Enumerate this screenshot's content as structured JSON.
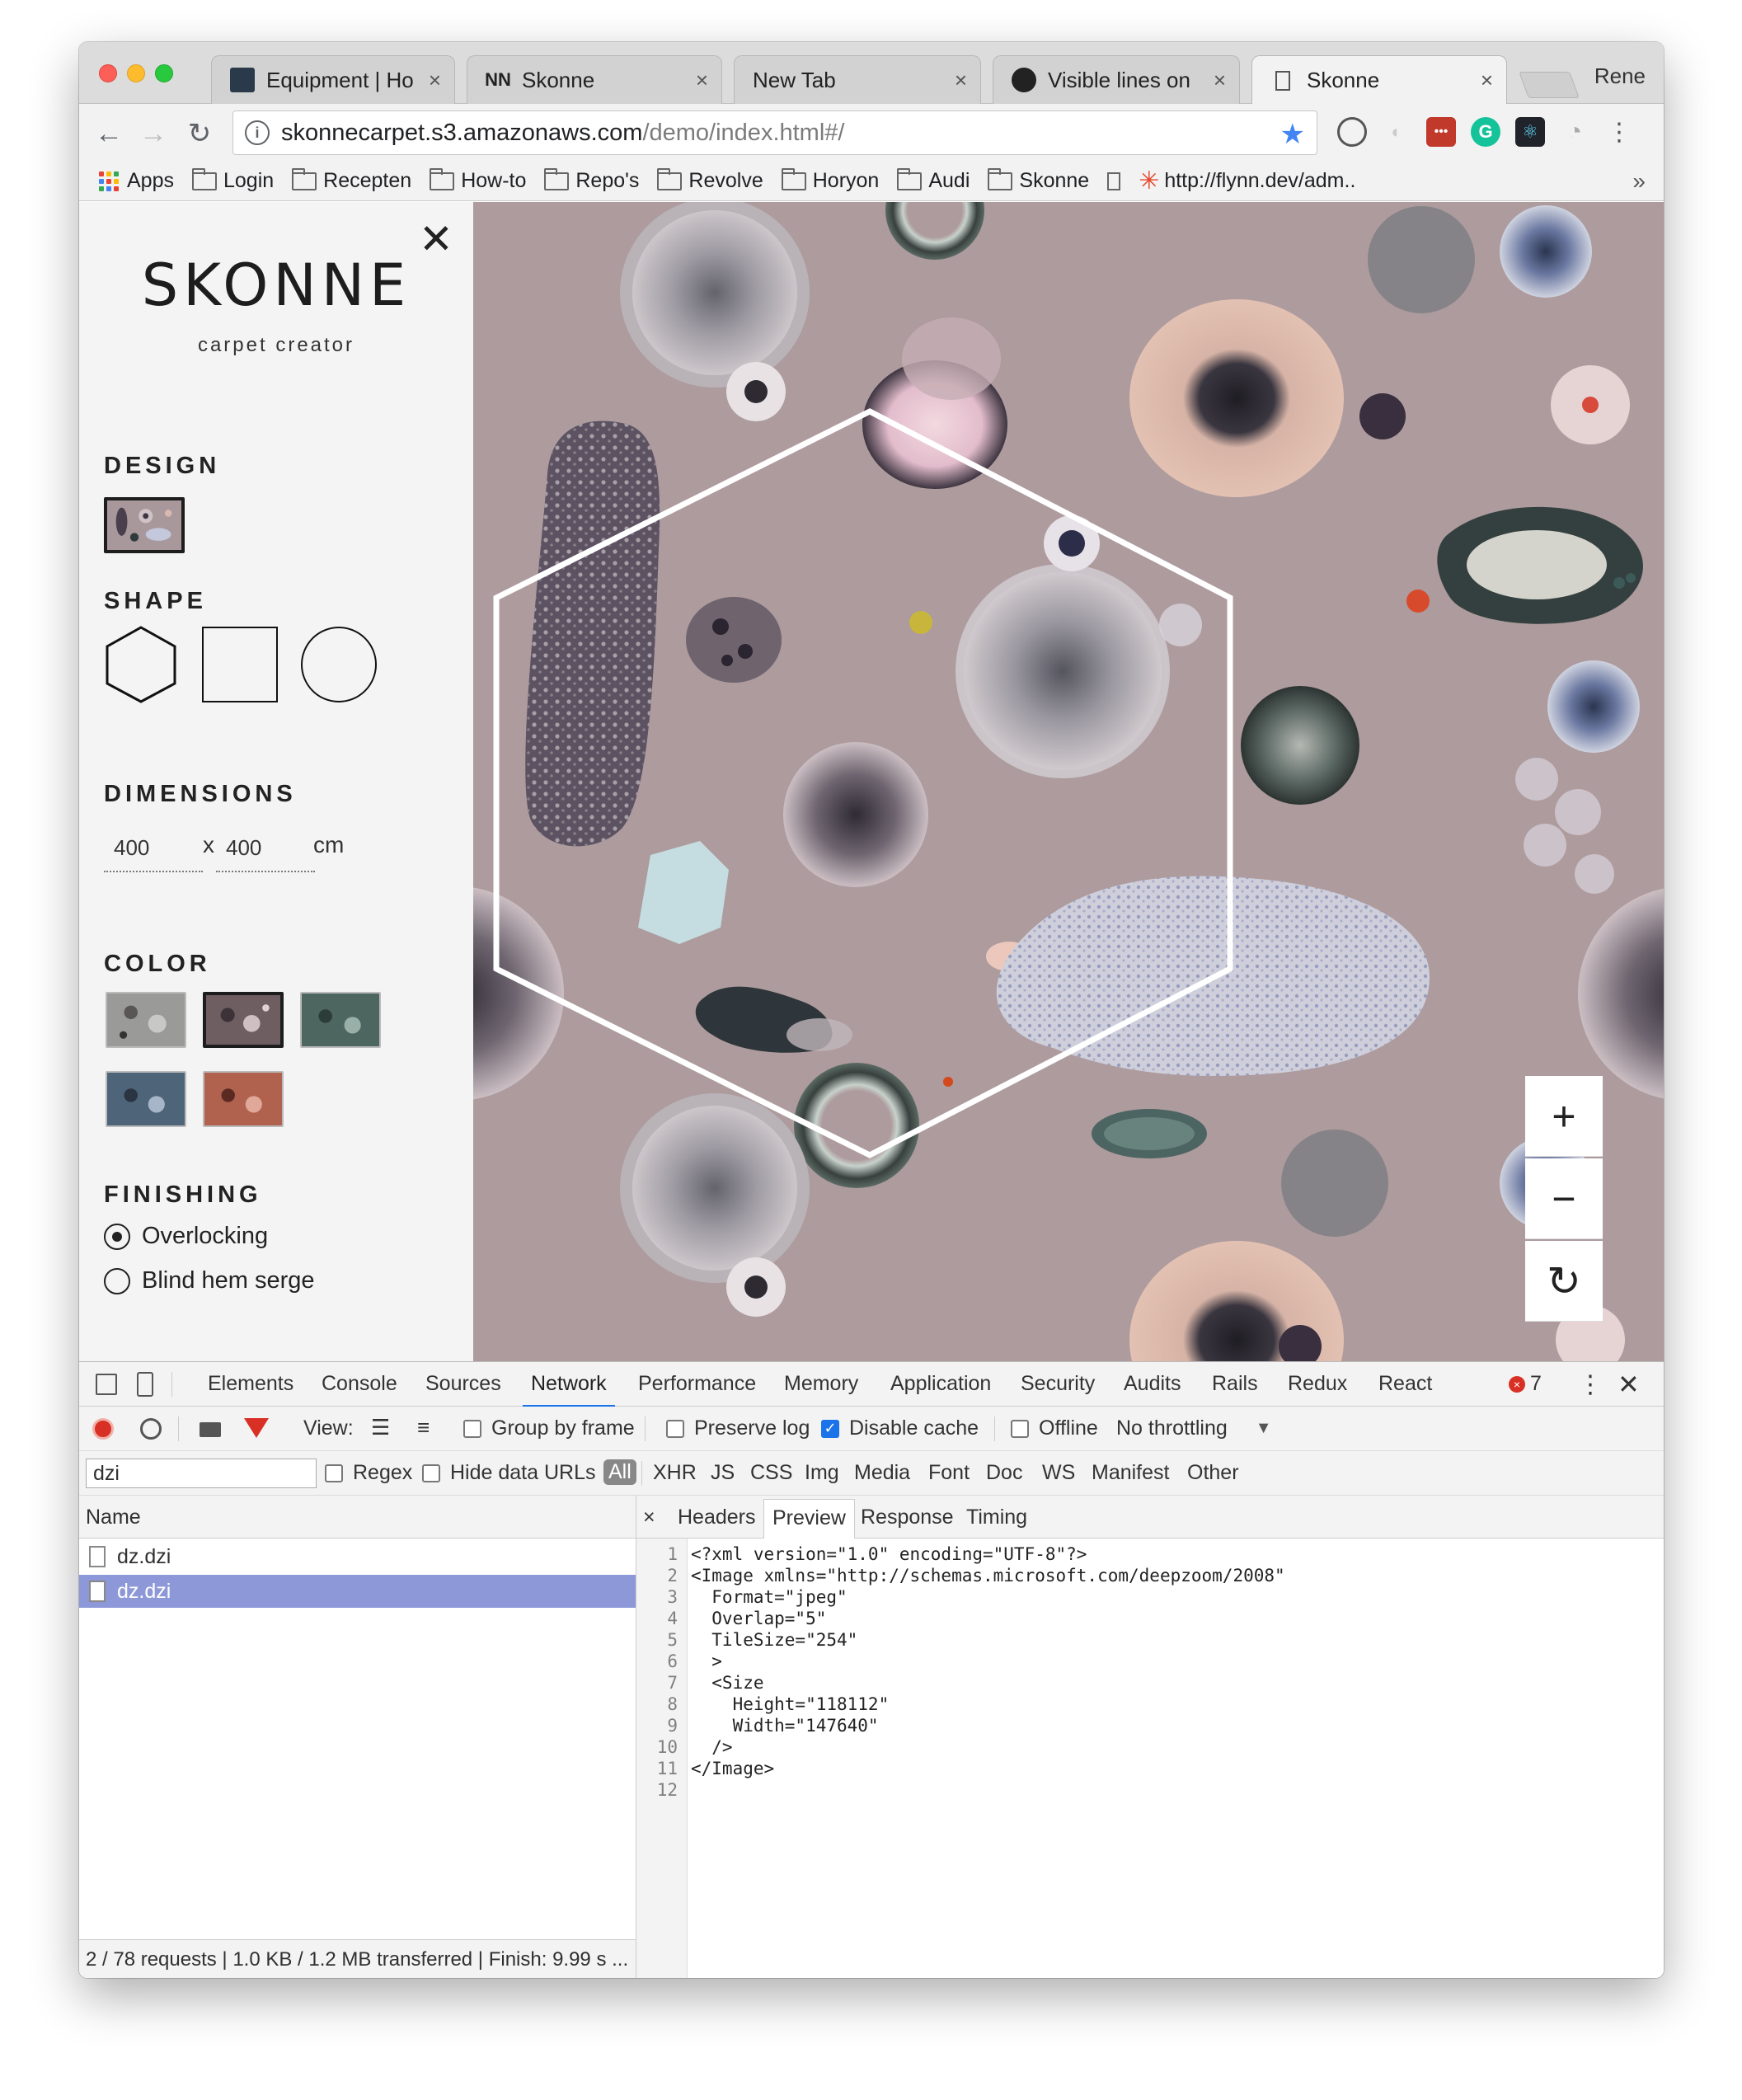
{
  "browser": {
    "tabs": [
      {
        "title": "Equipment | Horyon",
        "active": false
      },
      {
        "title": "Skonne",
        "active": false
      },
      {
        "title": "New Tab",
        "active": false
      },
      {
        "title": "Visible lines on Firefox",
        "active": false
      },
      {
        "title": "Skonne",
        "active": true
      }
    ],
    "profile": "Rene",
    "url_host": "skonnecarpet.s3.amazonaws.com",
    "url_path": "/demo/index.html#/",
    "bookmarks": [
      "Apps",
      "Login",
      "Recepten",
      "How-to",
      "Repo's",
      "Revolve",
      "Horyon",
      "Audi",
      "Skonne",
      "http://flynn.dev/adm.."
    ],
    "bookmarks_more": "»"
  },
  "sidebar": {
    "close": "✕",
    "logo": "SKONNE",
    "subtitle": "carpet creator",
    "design_title": "DESIGN",
    "shape_title": "SHAPE",
    "dimensions_title": "DIMENSIONS",
    "width": "400",
    "height": "400",
    "times": "x",
    "unit": "cm",
    "color_title": "COLOR",
    "finishing_title": "FINISHING",
    "finishing_options": [
      {
        "label": "Overlocking",
        "selected": true
      },
      {
        "label": "Blind hem serge",
        "selected": false
      }
    ]
  },
  "zoom_controls": {
    "zoom_in": "+",
    "zoom_out": "−",
    "reset": "↻"
  },
  "devtools": {
    "tabs": [
      "Elements",
      "Console",
      "Sources",
      "Network",
      "Performance",
      "Memory",
      "Application",
      "Security",
      "Audits",
      "Rails",
      "Redux",
      "React"
    ],
    "active_tab": "Network",
    "error_count": "7",
    "toolbar": {
      "view_label": "View:",
      "group_by_frame": "Group by frame",
      "preserve_log": "Preserve log",
      "disable_cache": "Disable cache",
      "offline": "Offline",
      "throttling": "No throttling"
    },
    "filter": {
      "value": "dzi",
      "regex": "Regex",
      "hide_data_urls": "Hide data URLs",
      "types": [
        "All",
        "XHR",
        "JS",
        "CSS",
        "Img",
        "Media",
        "Font",
        "Doc",
        "WS",
        "Manifest",
        "Other"
      ]
    },
    "requests": {
      "column": "Name",
      "rows": [
        "dz.dzi",
        "dz.dzi"
      ],
      "selected_index": 1,
      "footer": "2 / 78 requests | 1.0 KB / 1.2 MB transferred | Finish: 9.99 s ..."
    },
    "preview": {
      "close": "×",
      "tabs": [
        "Headers",
        "Preview",
        "Response",
        "Timing"
      ],
      "active_tab": "Preview",
      "lines": [
        "<?xml version=\"1.0\" encoding=\"UTF-8\"?>",
        "<Image xmlns=\"http://schemas.microsoft.com/deepzoom/2008\"",
        "  Format=\"jpeg\"",
        "  Overlap=\"5\"",
        "  TileSize=\"254\"",
        "  >",
        "  <Size",
        "    Height=\"118112\"",
        "    Width=\"147640\"",
        "  />",
        "</Image>",
        ""
      ]
    }
  },
  "colors": {
    "canvas_bg": "#ad9b9d",
    "accent": "#1a73e8",
    "selected_row": "#8d98d8",
    "error_red": "#d93025"
  }
}
